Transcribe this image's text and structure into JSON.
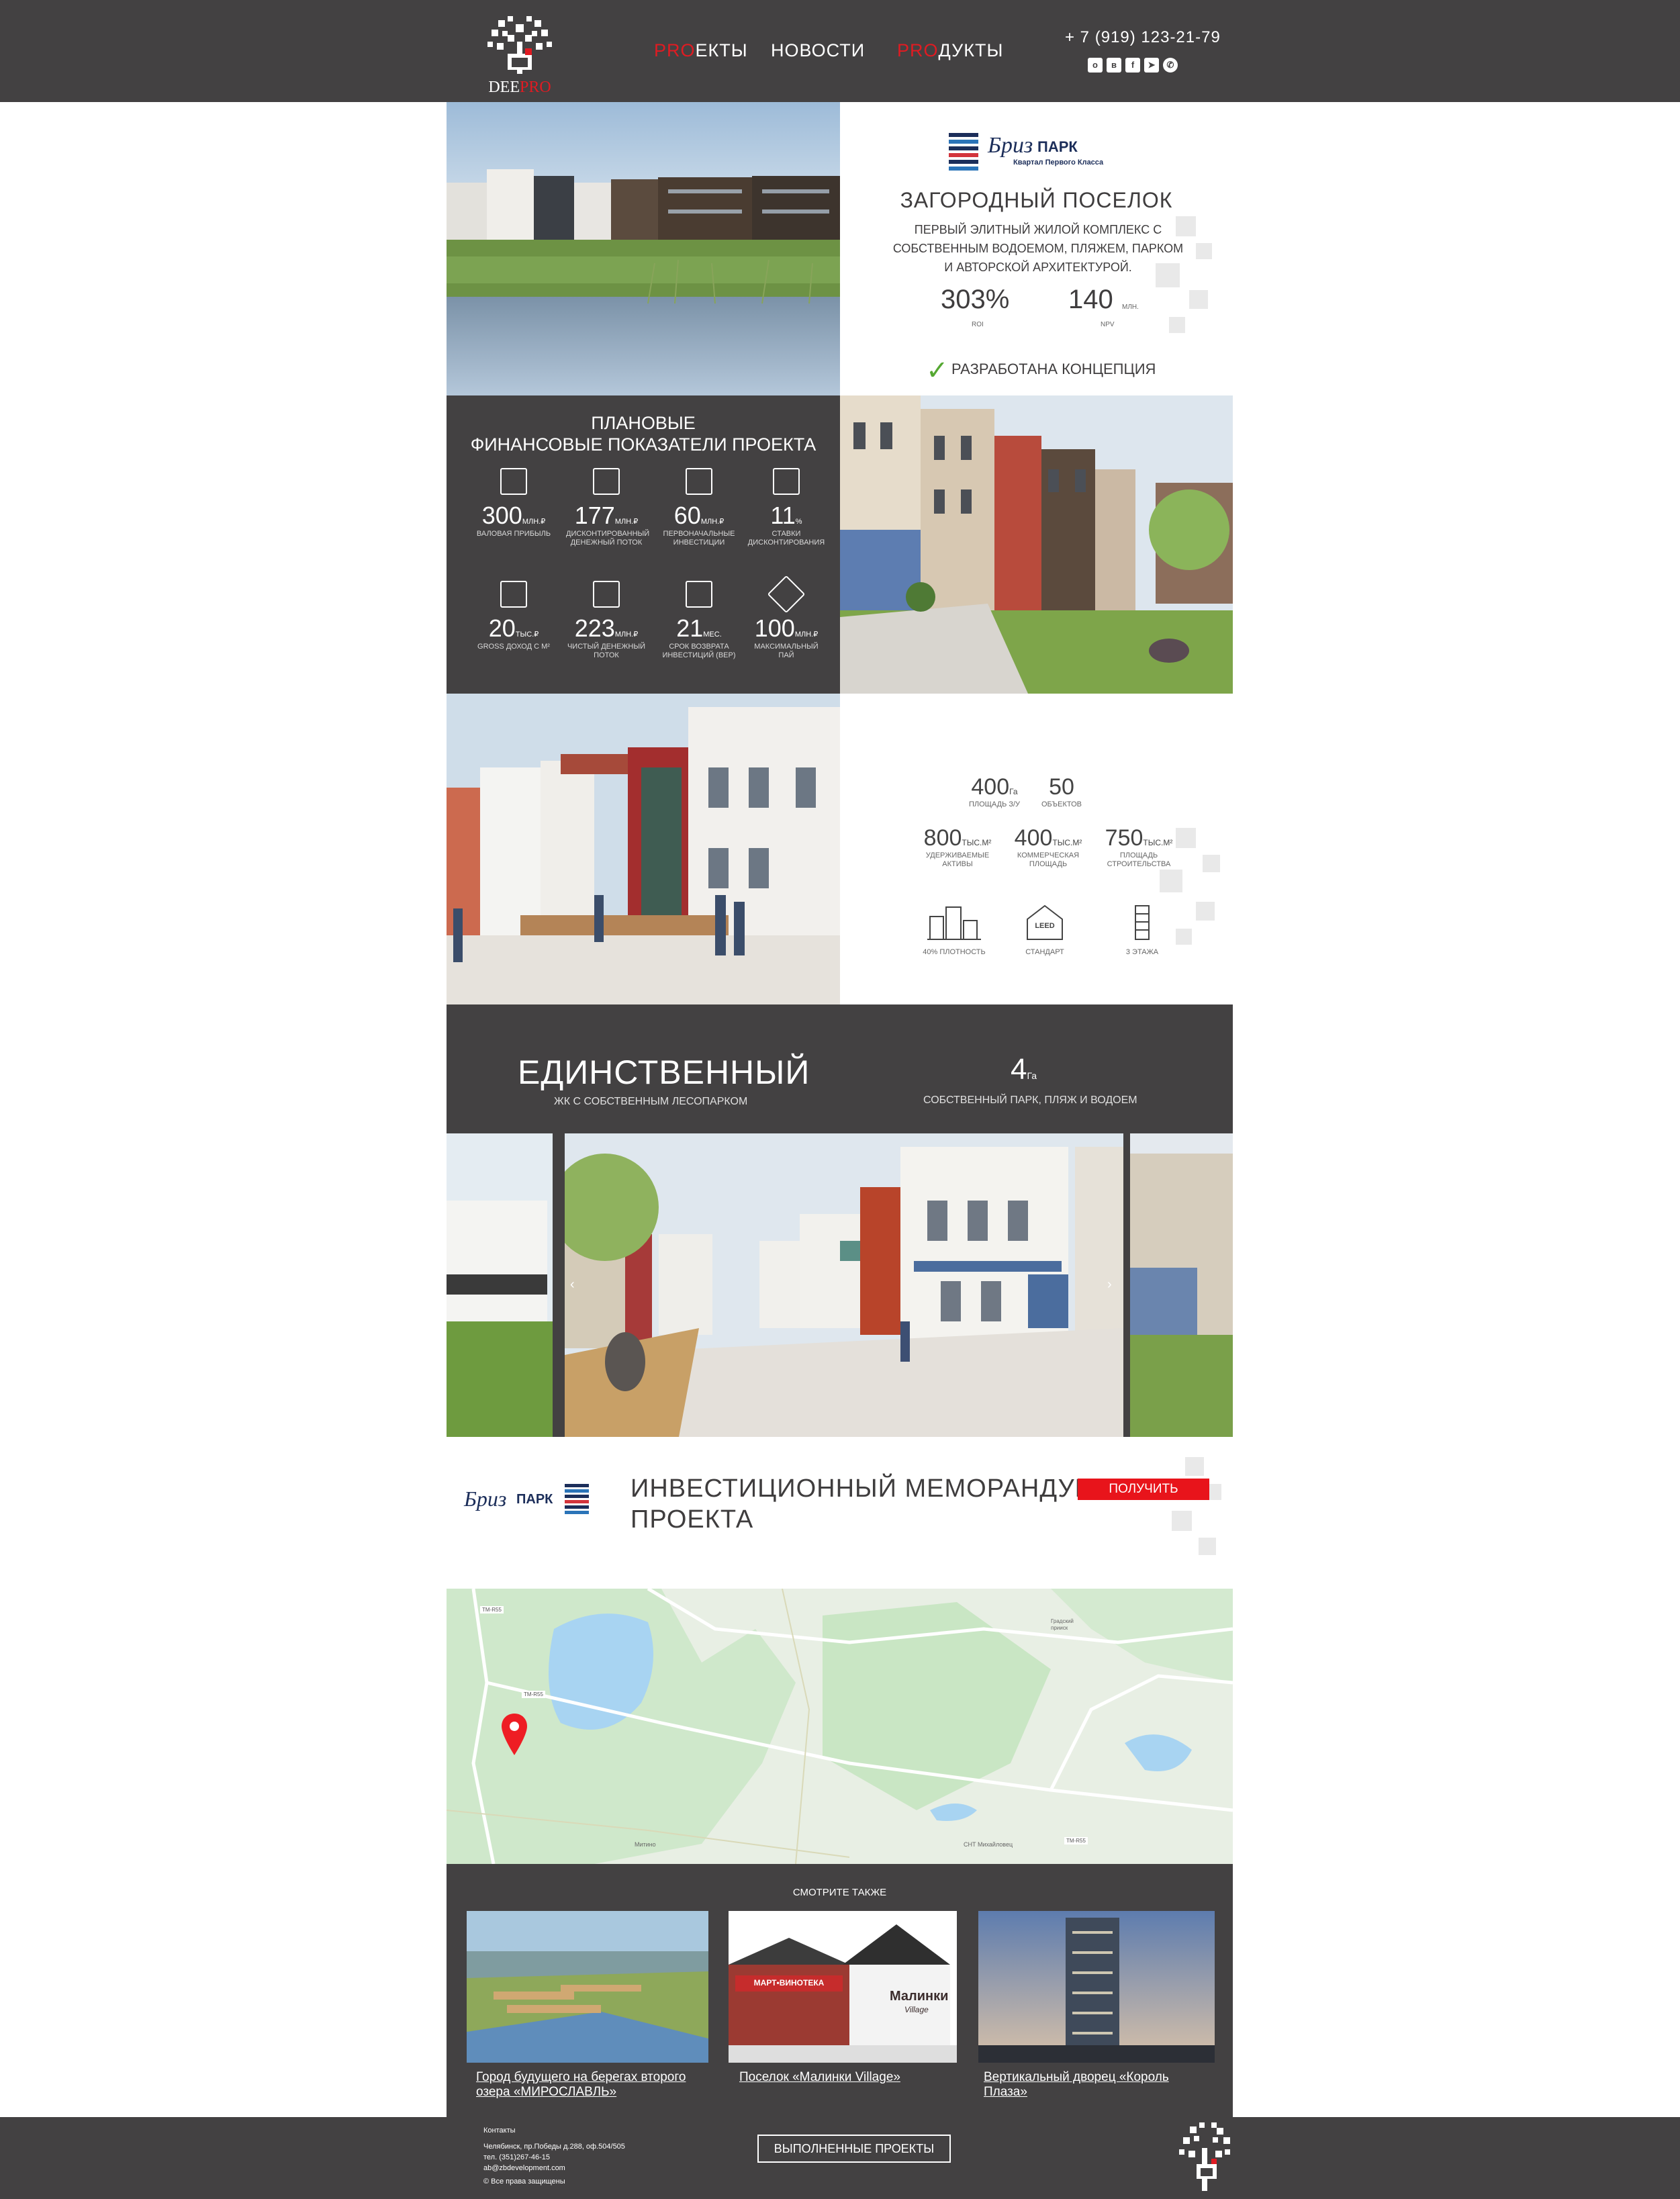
{
  "header": {
    "logo_text_a": "DEE",
    "logo_text_b": "PRO",
    "nav": [
      {
        "prefix": "PRO",
        "rest": "ЕКТЫ"
      },
      {
        "prefix": "",
        "rest": "НОВОСТИ"
      },
      {
        "prefix": "PRO",
        "rest": "ДУКТЫ"
      }
    ],
    "phone": "+ 7 (919) 123-21-79",
    "social_icons": [
      "ok-icon",
      "vk-icon",
      "facebook-icon",
      "telegram-icon",
      "whatsapp-icon"
    ]
  },
  "intro": {
    "brand_name": "Бриз",
    "brand_suffix": "ПАРК",
    "brand_tagline": "Квартал Первого Класса",
    "title": "ЗАГОРОДНЫЙ ПОСЕЛОК",
    "description": "ПЕРВЫЙ ЭЛИТНЫЙ ЖИЛОЙ КОМПЛЕКС С СОБСТВЕННЫМ ВОДОЕМОМ, ПЛЯЖЕМ, ПАРКОМ И АВТОРСКОЙ АРХИТЕКТУРОЙ.",
    "roi_value": "303%",
    "roi_label": "ROI",
    "npv_value": "140",
    "npv_unit": "МЛН.",
    "npv_label": "NPV",
    "status": "РАЗРАБОТАНА КОНЦЕПЦИЯ"
  },
  "finance": {
    "title_line1": "ПЛАНОВЫЕ",
    "title_line2": "ФИНАНСОВЫЕ ПОКАЗАТЕЛИ ПРОЕКТА",
    "metrics": [
      {
        "value": "300",
        "unit": "МЛН.₽",
        "label": "ВАЛОВАЯ ПРИБЫЛЬ"
      },
      {
        "value": "177",
        "unit": "МЛН.₽",
        "label": "ДИСКОНТИРОВАННЫЙ ДЕНЕЖНЫЙ ПОТОК"
      },
      {
        "value": "60",
        "unit": "МЛН.₽",
        "label": "ПЕРВОНАЧАЛЬНЫЕ ИНВЕСТИЦИИ"
      },
      {
        "value": "11",
        "unit": "%",
        "label": "СТАВКИ ДИСКОНТИРОВАНИЯ"
      },
      {
        "value": "20",
        "unit": "ТЫС.₽",
        "label": "GROSS ДОХОД С М²"
      },
      {
        "value": "223",
        "unit": "МЛН.₽",
        "label": "ЧИСТЫЙ ДЕНЕЖНЫЙ ПОТОК"
      },
      {
        "value": "21",
        "unit": "МЕС.",
        "label": "СРОК ВОЗВРАТА ИНВЕСТИЦИЙ (BEP)"
      },
      {
        "value": "100",
        "unit": "МЛН.₽",
        "label": "МАКСИМАЛЬНЫЙ ПАЙ"
      }
    ]
  },
  "stats": {
    "row1": [
      {
        "value": "400",
        "unit": "Га",
        "label": "ПЛОЩАДЬ З/У"
      },
      {
        "value": "50",
        "unit": "",
        "label": "ОБЪЕКТОВ"
      }
    ],
    "row2": [
      {
        "value": "800",
        "unit": "ТЫС.М²",
        "label": "УДЕРЖИВАЕМЫЕ АКТИВЫ"
      },
      {
        "value": "400",
        "unit": "ТЫС.М²",
        "label": "КОММЕРЧЕСКАЯ ПЛОЩАДЬ"
      },
      {
        "value": "750",
        "unit": "ТЫС.М²",
        "label": "ПЛОЩАДЬ СТРОИТЕЛЬСТВА"
      }
    ],
    "icons": [
      {
        "label": "40% ПЛОТНОСТЬ"
      },
      {
        "label": "СТАНДАРТ"
      },
      {
        "label": "3 ЭТАЖА"
      }
    ],
    "leed_text": "LEED"
  },
  "unique": {
    "title": "ЕДИНСТВЕННЫЙ",
    "subtitle": "ЖК С СОБСТВЕННЫМ ЛЕСОПАРКОМ",
    "area_value": "4",
    "area_unit": "Га",
    "area_label": "СОБСТВЕННЫЙ ПАРК, ПЛЯЖ И ВОДОЕМ"
  },
  "memorandum": {
    "brand_name": "Бриз",
    "brand_suffix": "ПАРК",
    "title_line1": "ИНВЕСТИЦИОННЫЙ МЕМОРАНДУМ",
    "title_line2": "ПРОЕКТА",
    "button": "ПОЛУЧИТЬ"
  },
  "map": {
    "road_labels": [
      "ТМ-R55",
      "ТМ-R55",
      "ТМ-R55"
    ],
    "place_labels": [
      "Градский прииск",
      "Митино",
      "СНТ Михайловец"
    ]
  },
  "see_also": {
    "title": "СМОТРИТЕ ТАКЖЕ",
    "cards": [
      {
        "title": "Город будущего на берегах второго озера «МИРОСЛАВЛЬ»"
      },
      {
        "title": "Поселок «Малинки Village»",
        "sign1": "МАРТ•ВИНОТЕКА",
        "sign2": "Малинки",
        "sign3": "Village"
      },
      {
        "title": "Вертикальный дворец «Король Плаза»"
      }
    ]
  },
  "footer": {
    "contacts_title": "Контакты",
    "address": "Челябинск, пр.Победы д.288, оф.504/505",
    "phone": "тел. (351)267-46-15",
    "email": "ab@zbdevelopment.com",
    "copyright": "© Все права защищены",
    "button": "ВЫПОЛНЕННЫЕ ПРОЕКТЫ"
  },
  "colors": {
    "dark": "#434142",
    "accent_red": "#e8141b",
    "map_land": "#e8efe4",
    "map_water": "#a8d4f2",
    "map_green": "#c9e6c4"
  }
}
